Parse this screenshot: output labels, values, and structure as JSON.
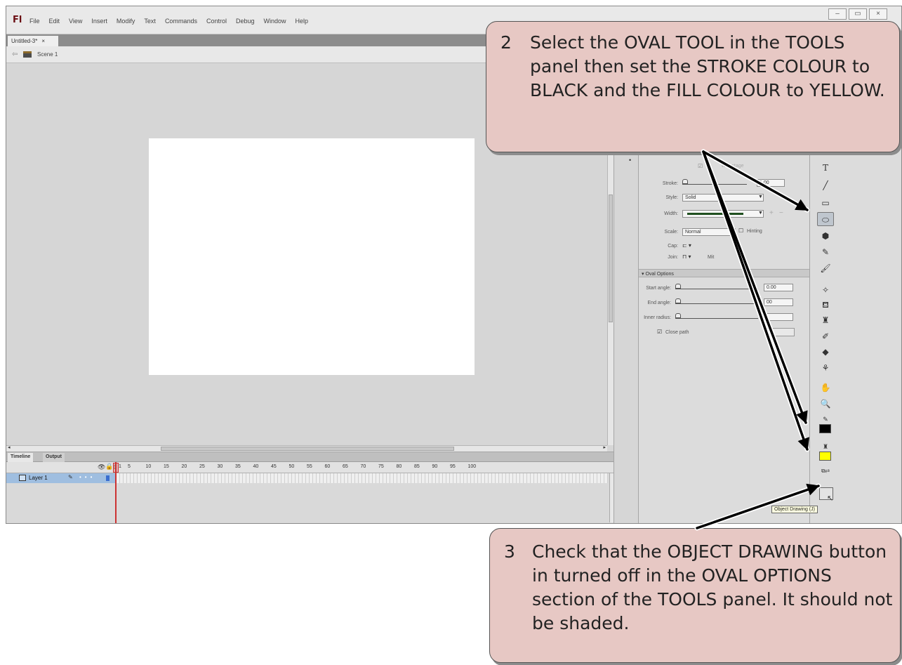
{
  "app": {
    "logo": "Fl",
    "menu": [
      "File",
      "Edit",
      "View",
      "Insert",
      "Modify",
      "Text",
      "Commands",
      "Control",
      "Debug",
      "Window",
      "Help"
    ],
    "window_controls": [
      "–",
      "▭",
      "×"
    ]
  },
  "document": {
    "tab_label": "Untitled-3*",
    "tab_close": "×"
  },
  "scene": {
    "label": "Scene 1"
  },
  "timeline": {
    "tabs": [
      "Timeline",
      "Output"
    ],
    "frame_numbers": [
      "1",
      "5",
      "10",
      "15",
      "20",
      "25",
      "30",
      "35",
      "40",
      "45",
      "50",
      "55",
      "60",
      "65",
      "70",
      "75",
      "80",
      "85",
      "90",
      "95",
      "100"
    ],
    "layer_name": "Layer 1"
  },
  "properties": {
    "stroke_label": "Stroke:",
    "stroke_value": "1.00",
    "style_label": "Style:",
    "style_value": "Solid",
    "width_label": "Width:",
    "scale_label": "Scale:",
    "scale_value": "Normal",
    "hinting_label": "Hinting",
    "cap_label": "Cap:",
    "join_label": "Join:",
    "miter_label": "Mit",
    "sync_label": "with stage",
    "oval_options_header": "Oval Options",
    "start_angle_label": "Start angle:",
    "start_angle_value": "0.00",
    "end_angle_label": "End angle:",
    "end_angle_value": "00",
    "inner_radius_label": "Inner radius:",
    "close_path_label": "Close path"
  },
  "tools": {
    "icons": [
      "text-tool-icon",
      "line-tool-icon",
      "rectangle-tool-icon",
      "oval-tool-icon",
      "polystar-tool-icon",
      "pencil-tool-icon",
      "brush-tool-icon",
      "deco-tool-icon",
      "paint-bucket-icon",
      "ink-bottle-icon",
      "eyedropper-icon",
      "eraser-icon",
      "bone-tool-icon",
      "hand-tool-icon",
      "zoom-tool-icon"
    ],
    "stroke_color": "#000000",
    "fill_color": "#ffff00",
    "tooltip": "Object Drawing (J)"
  },
  "callouts": {
    "step2_number": "2",
    "step2_text": "Select the OVAL TOOL in the TOOLS panel then set the STROKE COLOUR to BLACK and the FILL COLOUR to YELLOW.",
    "step3_number": "3",
    "step3_text": "Check that the OBJECT DRAWING button in turned off in the OVAL OPTIONS section of the TOOLS panel. It should not be shaded."
  }
}
